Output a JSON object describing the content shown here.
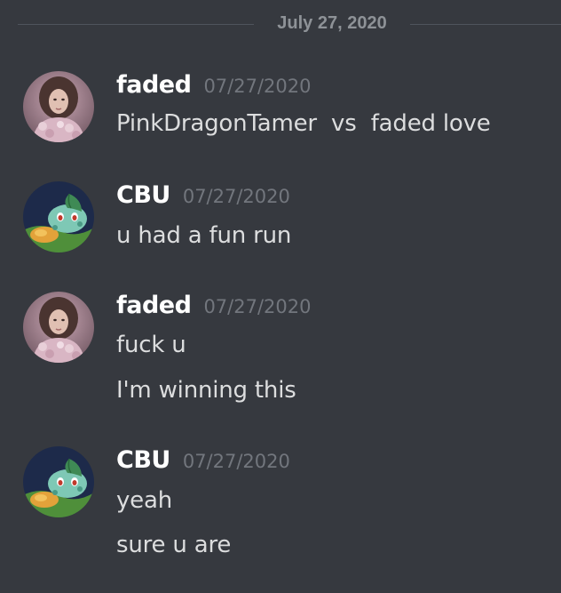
{
  "divider": {
    "date": "July 27, 2020"
  },
  "messages": [
    {
      "author": "faded",
      "timestamp": "07/27/2020",
      "avatar_icon": "woman-portrait-avatar",
      "lines": [
        "PinkDragonTamer  vs  faded love"
      ]
    },
    {
      "author": "CBU",
      "timestamp": "07/27/2020",
      "avatar_icon": "bulbasaur-avatar",
      "lines": [
        "u had a fun run"
      ]
    },
    {
      "author": "faded",
      "timestamp": "07/27/2020",
      "avatar_icon": "woman-portrait-avatar",
      "lines": [
        "fuck u",
        "I'm winning this"
      ]
    },
    {
      "author": "CBU",
      "timestamp": "07/27/2020",
      "avatar_icon": "bulbasaur-avatar",
      "lines": [
        "yeah",
        "sure u are"
      ]
    }
  ],
  "colors": {
    "background": "#36393f",
    "username": "#ffffff",
    "timestamp": "#72767d",
    "message_text": "#dcddde",
    "divider_line": "#4f545c",
    "divider_text": "#8e9297"
  }
}
